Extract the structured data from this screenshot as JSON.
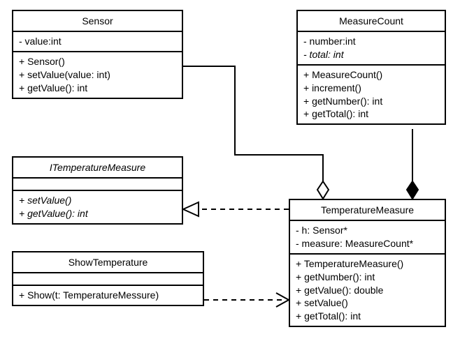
{
  "classes": {
    "sensor": {
      "title": "Sensor",
      "attrs": [
        "- value:int"
      ],
      "ops": [
        "+ Sensor()",
        "+ setValue(value: int)",
        "+ getValue(): int"
      ]
    },
    "measureCount": {
      "title": "MeasureCount",
      "attrs": [
        "- number:int",
        "- total: int"
      ],
      "ops": [
        "+ MeasureCount()",
        "+ increment()",
        "+ getNumber(): int",
        "+ getTotal(): int"
      ]
    },
    "iTemperatureMeasure": {
      "title": "ITemperatureMeasure",
      "attrs": [],
      "ops": [
        "+ setValue()",
        "+ getValue(): int"
      ]
    },
    "temperatureMeasure": {
      "title": "TemperatureMeasure",
      "attrs": [
        "- h: Sensor*",
        "- measure: MeasureCount*"
      ],
      "ops": [
        "+ TemperatureMeasure()",
        "+ getNumber(): int",
        "+ getValue(): double",
        "+ setValue()",
        "+ getTotal(): int"
      ]
    },
    "showTemperature": {
      "title": "ShowTemperature",
      "attrs": [],
      "ops": [
        "+ Show(t: TemperatureMessure)"
      ]
    }
  },
  "relations": [
    {
      "from": "Sensor",
      "to": "TemperatureMeasure",
      "type": "aggregation-hollow"
    },
    {
      "from": "MeasureCount",
      "to": "TemperatureMeasure",
      "type": "composition-filled"
    },
    {
      "from": "TemperatureMeasure",
      "to": "ITemperatureMeasure",
      "type": "realization-dashed-hollow-arrow"
    },
    {
      "from": "ShowTemperature",
      "to": "TemperatureMeasure",
      "type": "dependency-dashed-open-arrow"
    }
  ]
}
